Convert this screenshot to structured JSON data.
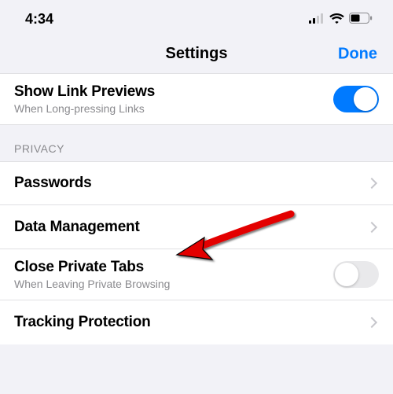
{
  "status_bar": {
    "time": "4:34"
  },
  "nav": {
    "title": "Settings",
    "done": "Done"
  },
  "general": {
    "show_link_previews": {
      "title": "Show Link Previews",
      "subtitle": "When Long-pressing Links",
      "on": true
    }
  },
  "privacy": {
    "header": "PRIVACY",
    "passwords": {
      "title": "Passwords"
    },
    "data_management": {
      "title": "Data Management"
    },
    "close_private_tabs": {
      "title": "Close Private Tabs",
      "subtitle": "When Leaving Private Browsing",
      "on": false
    },
    "tracking_protection": {
      "title": "Tracking Protection"
    }
  }
}
